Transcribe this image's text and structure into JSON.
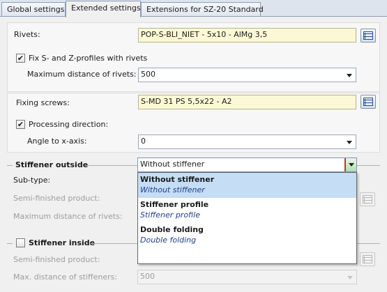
{
  "tabs": [
    "Global settings",
    "Extended settings",
    "Extensions for SZ-20 Standard"
  ],
  "rivets": {
    "label": "Rivets:",
    "value": "POP-S-BLI_NIET -  5x10 - AlMg 3,5",
    "fix_label": "Fix S- and Z-profiles with rivets",
    "fix_checked": "✔",
    "max_dist_label": "Maximum distance of rivets:",
    "max_dist_value": "500"
  },
  "screws": {
    "label": "Fixing screws:",
    "value": "S-MD 31 PS 5,5x22 - A2",
    "proc_label": "Processing direction:",
    "proc_checked": "✔",
    "angle_label": "Angle to x-axis:",
    "angle_value": "0"
  },
  "stiffener_outside": {
    "title": "Stiffener outside",
    "subtype_label": "Sub-type:",
    "subtype_value": "Without stiffener",
    "semi_label": "Semi-finished product:",
    "max_rivets_label": "Maximum distance of rivets:",
    "options": [
      {
        "title": "Without stiffener",
        "subtitle": "Without stiffener"
      },
      {
        "title": "Stiffener profile",
        "subtitle": "Stiffener profile"
      },
      {
        "title": "Double folding",
        "subtitle": "Double folding"
      }
    ]
  },
  "stiffener_inside": {
    "title": "Stiffener inside",
    "semi_label": "Semi-finished product:",
    "max_dist_label": "Max. distance of stiffeners:",
    "max_dist_value": "500"
  },
  "colors": {
    "yellow_field": "#fbf9d5",
    "selected_option": "#c5ddf5",
    "accent_border": "#c9302c"
  }
}
